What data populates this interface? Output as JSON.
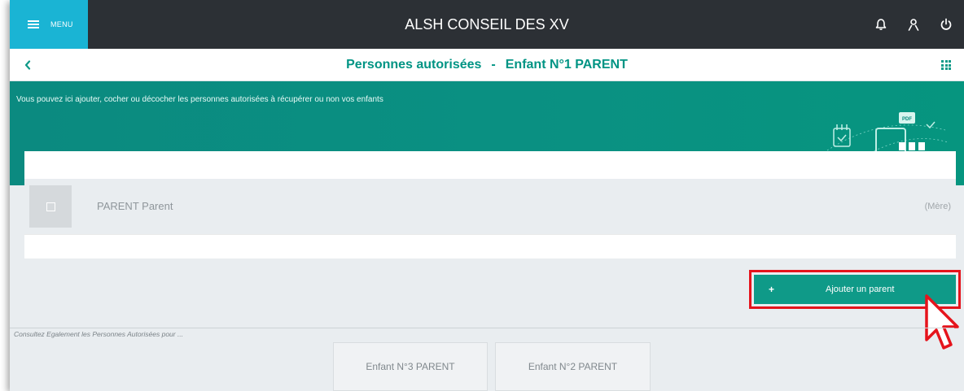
{
  "topbar": {
    "menu_label": "MENU",
    "app_title": "ALSH CONSEIL DES XV",
    "icons": [
      "bell-icon",
      "user-icon",
      "power-icon"
    ]
  },
  "subheader": {
    "title_part1": "Personnes autorisées",
    "title_separator": "-",
    "title_part2": "Enfant N°1 PARENT"
  },
  "banner": {
    "text": "Vous pouvez ici ajouter, cocher ou décocher les personnes autorisées à récupérer ou non vos enfants",
    "art_label": "PDF"
  },
  "persons": [
    {
      "name": "PARENT Parent",
      "relation": "(Mère)",
      "checked": false
    }
  ],
  "actions": {
    "add_parent_plus": "+",
    "add_parent_label": "Ajouter un parent"
  },
  "consult": {
    "label": "Consultez Egalement les Personnes Autorisées pour ...",
    "children": [
      "Enfant N°3 PARENT",
      "Enfant N°2 PARENT"
    ]
  },
  "colors": {
    "topbar": "#2c3035",
    "menu_accent": "#1ab4d4",
    "brand_green": "#0f9a88",
    "highlight_red": "#e5141c"
  }
}
